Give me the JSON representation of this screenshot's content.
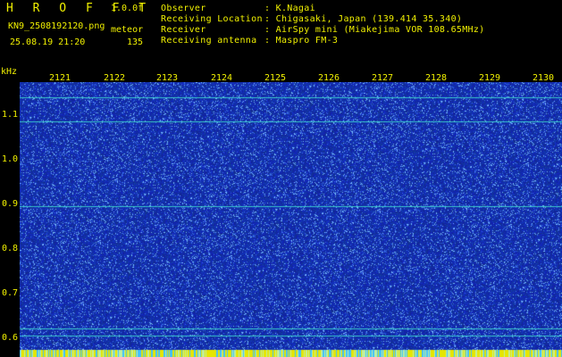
{
  "header": {
    "logo": "H R O F F T",
    "version": "1.0.0f",
    "filename": "KN9_2508192120.png",
    "datetime": "25.08.19 21:20",
    "meteor_label": "meteor",
    "meteor_count": "135",
    "info_labels": [
      "Observer",
      "Receiving Location",
      "Receiver",
      "Receiving antenna"
    ],
    "info_values": [
      ": K.Nagai",
      ": Chigasaki, Japan (139.414 35.340)",
      ": AirSpy mini (Miakejima VOR 108.65MHz)",
      ": Maspro FM-3"
    ]
  },
  "y_axis": {
    "unit": "kHz",
    "ticks": [
      "1.1",
      "1.0",
      "0.9",
      "0.8",
      "0.7",
      "0.6"
    ]
  },
  "x_axis": {
    "ticks": [
      "2121",
      "2122",
      "2123",
      "2124",
      "2125",
      "2126",
      "2127",
      "2128",
      "2129",
      "2130"
    ]
  },
  "colors": {
    "text": "#f0f000",
    "background": "#000000",
    "spectrogram_base": "#1a2fb0",
    "noise_light": "#7fc8ff",
    "signal_line": "#40e0d0"
  }
}
